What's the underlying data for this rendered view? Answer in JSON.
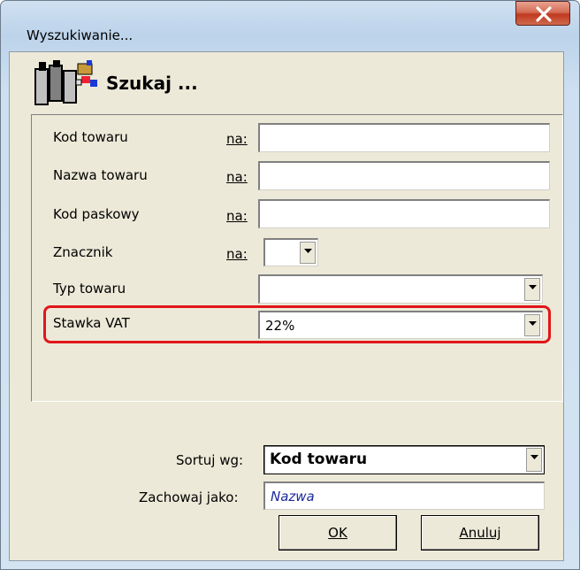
{
  "window": {
    "title": "Wyszukiwanie..."
  },
  "header": {
    "title": "Szukaj ...",
    "icon": "binoculars-search-icon"
  },
  "fields": [
    {
      "label": "Kod towaru",
      "na": "na:",
      "value": ""
    },
    {
      "label": "Nazwa towaru",
      "na": "na:",
      "value": ""
    },
    {
      "label": "Kod paskowy",
      "na": "na:",
      "value": ""
    },
    {
      "label": "Znacznik",
      "na": "na:",
      "value": ""
    },
    {
      "label": "Typ towaru",
      "value": ""
    },
    {
      "label": "Stawka VAT",
      "value": "22%"
    }
  ],
  "sort": {
    "label": "Sortuj wg:",
    "value": "Kod towaru"
  },
  "save_as": {
    "label": "Zachowaj jako:",
    "value": "Nazwa"
  },
  "buttons": {
    "ok": "OK",
    "cancel": "Anuluj"
  },
  "colors": {
    "highlight": "#e0161b",
    "close_button": "#c0391f"
  }
}
